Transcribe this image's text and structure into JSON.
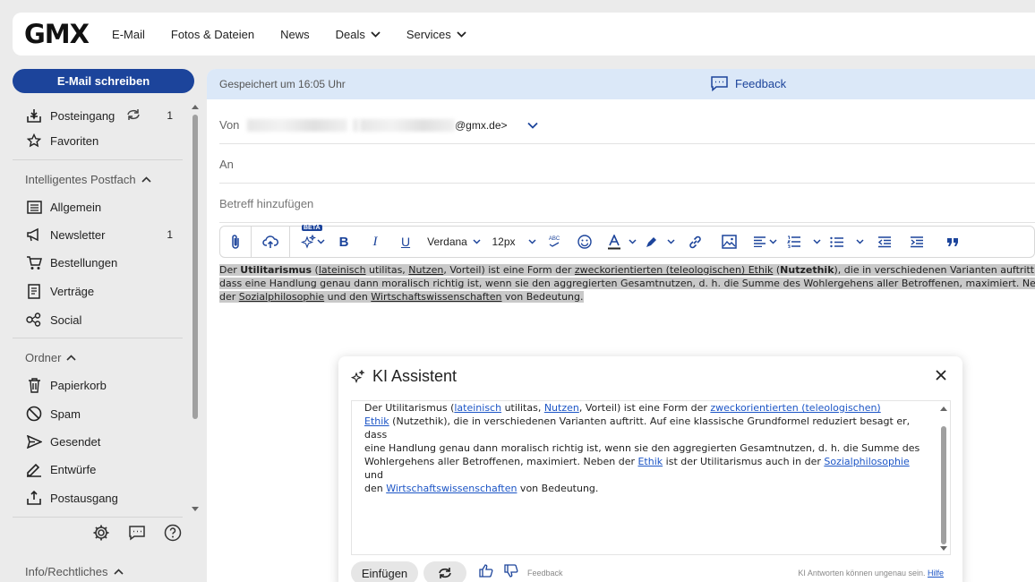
{
  "header": {
    "logo": "GMX",
    "nav": [
      {
        "label": "E-Mail",
        "dropdown": false
      },
      {
        "label": "Fotos & Dateien",
        "dropdown": false
      },
      {
        "label": "News",
        "dropdown": false
      },
      {
        "label": "Deals",
        "dropdown": true
      },
      {
        "label": "Services",
        "dropdown": true
      }
    ]
  },
  "compose_label": "E-Mail schreiben",
  "sidebar": {
    "inbox": {
      "label": "Posteingang",
      "count": "1"
    },
    "favorites": "Favoriten",
    "smart_head": "Intelligentes Postfach",
    "smart": [
      {
        "label": "Allgemein",
        "count": ""
      },
      {
        "label": "Newsletter",
        "count": "1"
      },
      {
        "label": "Bestellungen",
        "count": ""
      },
      {
        "label": "Verträge",
        "count": ""
      },
      {
        "label": "Social",
        "count": ""
      }
    ],
    "folders_head": "Ordner",
    "folders": [
      "Papierkorb",
      "Spam",
      "Gesendet",
      "Entwürfe",
      "Postausgang"
    ],
    "info": "Info/Rechtliches"
  },
  "compose": {
    "saved": "Gespeichert um 16:05 Uhr",
    "feedback": "Feedback",
    "from_label": "Von",
    "from_suffix": "@gmx.de>",
    "to_label": "An",
    "subject_placeholder": "Betreff hinzufügen",
    "toolbar": {
      "beta": "BETA",
      "font": "Verdana",
      "size": "12px",
      "spell": "ABC"
    }
  },
  "body": {
    "line1": {
      "t1": "Der ",
      "b1": "Utilitarismus",
      "t2": " (",
      "u1": "lateinisch",
      "t3": " utilitas, ",
      "u2": "Nutzen",
      "t4": ", Vorteil) ist eine Form der ",
      "u3": "zweckorientierten (teleologischen) Ethik",
      "t5": " (",
      "b2": "Nutzethik",
      "t6": "), die in verschiedenen Varianten auftritt. Auf ei"
    },
    "line2": "dass eine Handlung genau dann moralisch richtig ist, wenn sie den aggregierten Gesamtnutzen, d. h. die Summe des Wohlergehens aller Betroffenen, maximiert. Neben der",
    "line3": {
      "t1": "der ",
      "u1": "Sozialphilosophie",
      "t2": " und den ",
      "u2": "Wirtschaftswissenschaften",
      "t3": " von Bedeutung."
    }
  },
  "ki": {
    "title": "KI Assistent",
    "l1": {
      "t1": "Der Utilitarismus (",
      "a1": "lateinisch",
      "t2": " utilitas, ",
      "a2": "Nutzen",
      "t3": ", Vorteil) ist eine Form der ",
      "a3": "zweckorientierten (teleologischen)"
    },
    "l2": {
      "a1": "Ethik",
      "t1": " (Nutzethik), die in verschiedenen Varianten auftritt. Auf eine klassische Grundformel reduziert besagt er, dass"
    },
    "l3": "eine Handlung genau dann moralisch richtig ist, wenn sie den aggregierten Gesamtnutzen, d. h. die Summe des",
    "l4": {
      "t1": "Wohlergehens aller Betroffenen, maximiert. Neben der ",
      "a1": "Ethik",
      "t2": " ist der Utilitarismus auch in der ",
      "a2": "Sozialphilosophie",
      "t3": " und"
    },
    "l5": {
      "t1": "den ",
      "a1": "Wirtschaftswissenschaften",
      "t2": " von Bedeutung."
    },
    "insert": "Einfügen",
    "feedback": "Feedback",
    "disclaimer": "KI Antworten können ungenau sein.",
    "help": "Hilfe"
  }
}
